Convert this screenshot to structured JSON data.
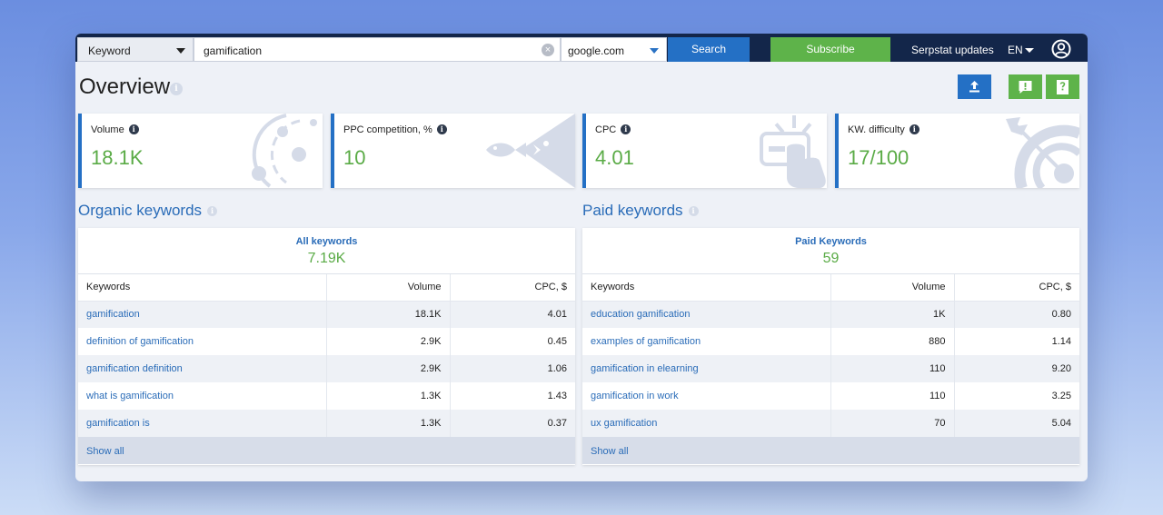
{
  "toolbar": {
    "search_type": "Keyword",
    "query": "gamification",
    "database": "google.com",
    "search_label": "Search",
    "subscribe_label": "Subscribe",
    "updates_label": "Serpstat updates",
    "language": "EN"
  },
  "page": {
    "title": "Overview"
  },
  "cards": [
    {
      "label": "Volume",
      "value": "18.1K",
      "art": "orbit-icon"
    },
    {
      "label": "PPC competition, %",
      "value": "10",
      "art": "fish-icon"
    },
    {
      "label": "CPC",
      "value": "4.01",
      "art": "click-icon"
    },
    {
      "label": "KW. difficulty",
      "value": "17/100",
      "art": "target-icon"
    }
  ],
  "organic": {
    "title": "Organic keywords",
    "summary_label": "All keywords",
    "summary_value": "7.19K",
    "columns": [
      "Keywords",
      "Volume",
      "CPC, $"
    ],
    "rows": [
      [
        "gamification",
        "18.1K",
        "4.01"
      ],
      [
        "definition of gamification",
        "2.9K",
        "0.45"
      ],
      [
        "gamification definition",
        "2.9K",
        "1.06"
      ],
      [
        "what is gamification",
        "1.3K",
        "1.43"
      ],
      [
        "gamification is",
        "1.3K",
        "0.37"
      ]
    ],
    "show_all": "Show all"
  },
  "paid": {
    "title": "Paid keywords",
    "summary_label": "Paid Keywords",
    "summary_value": "59",
    "columns": [
      "Keywords",
      "Volume",
      "CPC, $"
    ],
    "rows": [
      [
        "education gamification",
        "1K",
        "0.80"
      ],
      [
        "examples of gamification",
        "880",
        "1.14"
      ],
      [
        "gamification in elearning",
        "110",
        "9.20"
      ],
      [
        "gamification in work",
        "110",
        "3.25"
      ],
      [
        "ux gamification",
        "70",
        "5.04"
      ]
    ],
    "show_all": "Show all"
  },
  "colors": {
    "accent_blue": "#2470c5",
    "accent_green": "#5eb34a",
    "topbar": "#13264a",
    "value_green": "#5aab46"
  }
}
